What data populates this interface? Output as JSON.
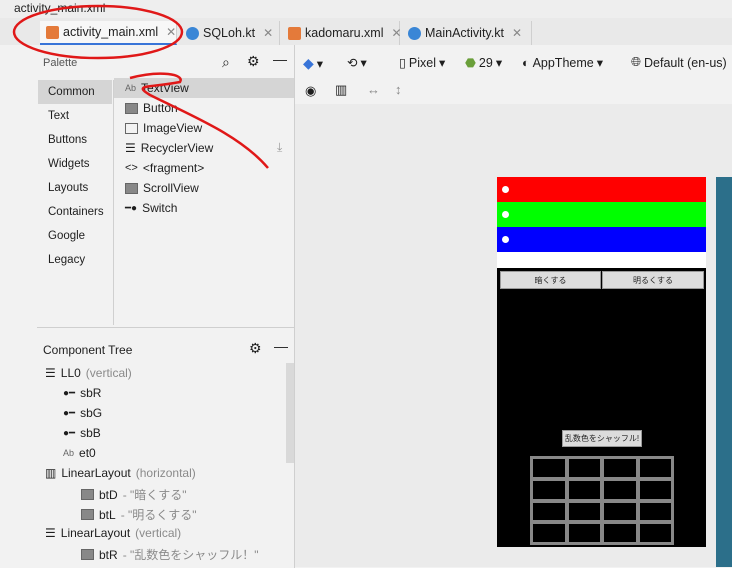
{
  "breadcrumb": {
    "file": "activity_main.xml"
  },
  "tabs": [
    {
      "label": "activity_main.xml",
      "type": "xml",
      "active": true
    },
    {
      "label": "SQLoh.kt",
      "type": "kt",
      "active": false
    },
    {
      "label": "kadomaru.xml",
      "type": "xml",
      "active": false
    },
    {
      "label": "MainActivity.kt",
      "type": "kt",
      "active": false
    }
  ],
  "palette": {
    "title": "Palette",
    "categories": [
      "Common",
      "Text",
      "Buttons",
      "Widgets",
      "Layouts",
      "Containers",
      "Google",
      "Legacy"
    ],
    "items": [
      "TextView",
      "Button",
      "ImageView",
      "RecyclerView",
      "<fragment>",
      "ScrollView",
      "Switch"
    ]
  },
  "tree": {
    "title": "Component Tree",
    "nodes": [
      {
        "name": "LL0",
        "type": "(vertical)"
      },
      {
        "name": "sbR",
        "type": ""
      },
      {
        "name": "sbG",
        "type": ""
      },
      {
        "name": "sbB",
        "type": ""
      },
      {
        "name": "et0",
        "type": ""
      },
      {
        "name": "LinearLayout",
        "type": "(horizontal)"
      },
      {
        "name": "btD",
        "type": "- \"暗くする\""
      },
      {
        "name": "btL",
        "type": "- \"明るくする\""
      },
      {
        "name": "LinearLayout",
        "type": "(vertical)"
      },
      {
        "name": "btR",
        "type": "- \"乱数色をシャッフル！\""
      }
    ]
  },
  "toolbar": {
    "device": "Pixel",
    "api": "29",
    "theme": "AppTheme",
    "locale": "Default (en-us)"
  },
  "phone": {
    "btn_dark": "暗くする",
    "btn_light": "明るくする",
    "btn_shuffle": "乱数色をシャッフル!",
    "colors": {
      "red": "#ff0000",
      "green": "#00ff00",
      "blue": "#0000ff"
    }
  }
}
